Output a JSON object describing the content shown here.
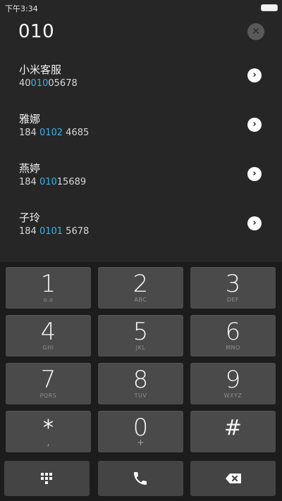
{
  "status_bar": {
    "time": "下午3:34"
  },
  "dialer": {
    "number": "010"
  },
  "results": [
    {
      "name": "小米客服",
      "number_pre": "40",
      "number_hl": "010",
      "number_post": "05678"
    },
    {
      "name": "雅娜",
      "number_pre": "184 ",
      "number_hl": "0102",
      "number_post": " 4685"
    },
    {
      "name": "燕婷",
      "number_pre": "184 ",
      "number_hl": "010",
      "number_post": "15689"
    },
    {
      "name": "子玲",
      "number_pre": "184 ",
      "number_hl": "0101",
      "number_post": " 5678"
    }
  ],
  "keypad": {
    "keys": [
      {
        "digit": "1",
        "letters": "o.o"
      },
      {
        "digit": "2",
        "letters": "ABC"
      },
      {
        "digit": "3",
        "letters": "DEF"
      },
      {
        "digit": "4",
        "letters": "GHI"
      },
      {
        "digit": "5",
        "letters": "JKL"
      },
      {
        "digit": "6",
        "letters": "MNO"
      },
      {
        "digit": "7",
        "letters": "PQRS"
      },
      {
        "digit": "8",
        "letters": "TUV"
      },
      {
        "digit": "9",
        "letters": "WXYZ"
      },
      {
        "digit": "*",
        "letters": ","
      },
      {
        "digit": "0",
        "letters": "+"
      },
      {
        "digit": "#",
        "letters": ""
      }
    ]
  },
  "colors": {
    "highlight": "#39b4e6",
    "background": "#262626",
    "key": "#4a4a4a"
  },
  "icons": {
    "dialpad": "dialpad-icon",
    "call": "phone-icon",
    "delete": "backspace-icon",
    "clear": "clear-icon",
    "detail": "chevron-right-icon"
  }
}
